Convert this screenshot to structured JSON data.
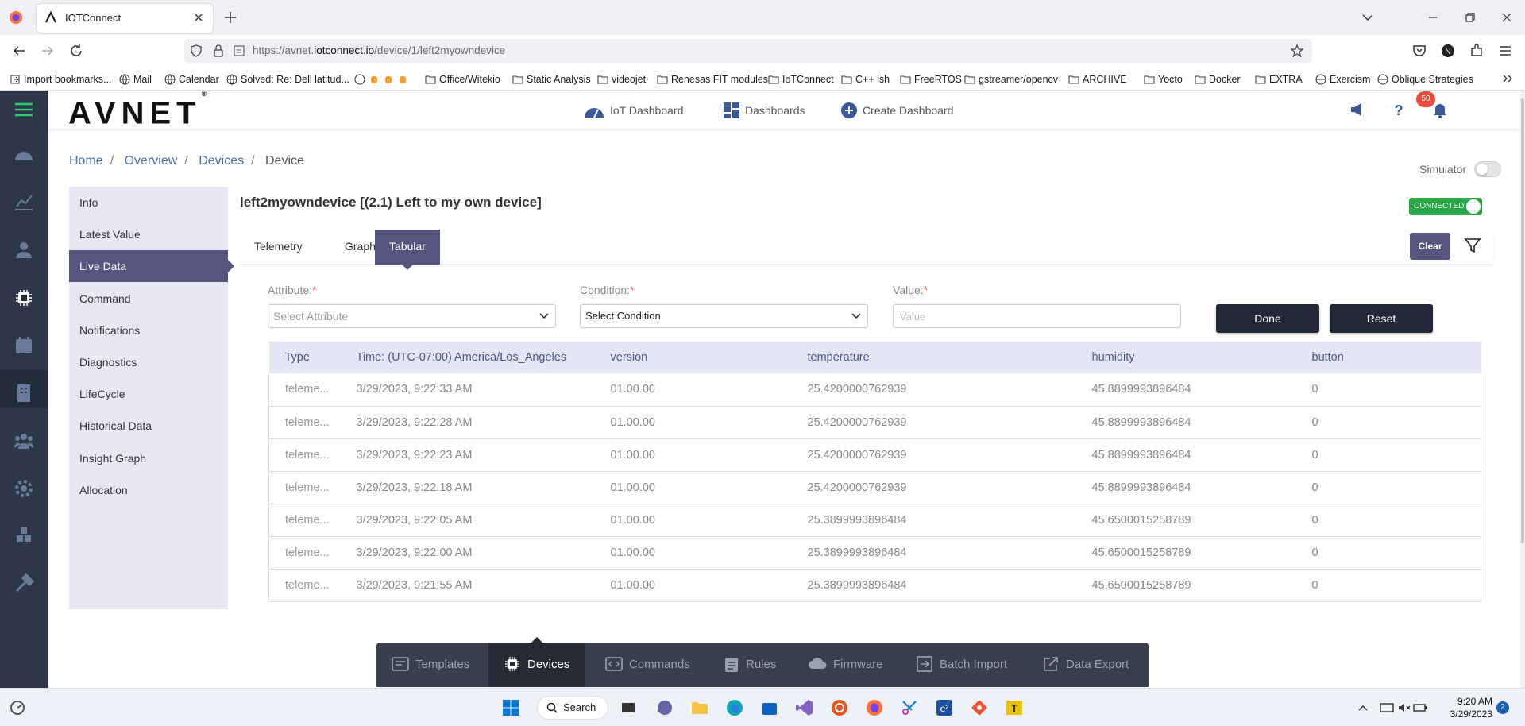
{
  "browser": {
    "tab_title": "IOTConnect",
    "url_prefix": "https://avnet.",
    "url_domain": "iotconnect.io",
    "url_path": "/device/1/left2myowndevice",
    "bookmarks": [
      "Import bookmarks...",
      "Mail",
      "Calendar",
      "Solved: Re: Dell latitud...",
      "Office/Witekio",
      "Static Analysis",
      "videojet",
      "Renesas FIT modules",
      "IoTConnect",
      "C++ ish",
      "FreeRTOS",
      "gstreamer/opencv",
      "ARCHIVE",
      "Yocto",
      "Docker",
      "EXTRA",
      "Exercism",
      "Oblique Strategies"
    ]
  },
  "header": {
    "logo": "AVNET",
    "logo_mark": "®",
    "nav": [
      "IoT Dashboard",
      "Dashboards",
      "Create Dashboard"
    ],
    "notification_count": "50"
  },
  "breadcrumb": [
    "Home",
    "Overview",
    "Devices",
    "Device"
  ],
  "simulator_label": "Simulator",
  "side_menu": [
    "Info",
    "Latest Value",
    "Live Data",
    "Command",
    "Notifications",
    "Diagnostics",
    "LifeCycle",
    "Historical Data",
    "Insight Graph",
    "Allocation"
  ],
  "device": {
    "title": "left2myowndevice [(2.1) Left to my own device]",
    "status": "CONNECTED"
  },
  "tabs": [
    "Telemetry",
    "Graph",
    "Tabular"
  ],
  "clear_label": "Clear",
  "filter": {
    "attribute_label": "Attribute:",
    "attribute_placeholder": "Select Attribute",
    "condition_label": "Condition:",
    "condition_value": "Select Condition",
    "value_label": "Value:",
    "value_placeholder": "Value",
    "required_mark": "*",
    "done_label": "Done",
    "reset_label": "Reset"
  },
  "table": {
    "columns": [
      "Type",
      "Time: (UTC-07:00) America/Los_Angeles",
      "version",
      "temperature",
      "humidity",
      "button"
    ],
    "rows": [
      [
        "teleme...",
        "3/29/2023, 9:22:33 AM",
        "01.00.00",
        "25.4200000762939",
        "45.8899993896484",
        "0"
      ],
      [
        "teleme...",
        "3/29/2023, 9:22:28 AM",
        "01.00.00",
        "25.4200000762939",
        "45.8899993896484",
        "0"
      ],
      [
        "teleme...",
        "3/29/2023, 9:22:23 AM",
        "01.00.00",
        "25.4200000762939",
        "45.8899993896484",
        "0"
      ],
      [
        "teleme...",
        "3/29/2023, 9:22:18 AM",
        "01.00.00",
        "25.4200000762939",
        "45.8899993896484",
        "0"
      ],
      [
        "teleme...",
        "3/29/2023, 9:22:05 AM",
        "01.00.00",
        "25.3899993896484",
        "45.6500015258789",
        "0"
      ],
      [
        "teleme...",
        "3/29/2023, 9:22:00 AM",
        "01.00.00",
        "25.3899993896484",
        "45.6500015258789",
        "0"
      ],
      [
        "teleme...",
        "3/29/2023, 9:21:55 AM",
        "01.00.00",
        "25.3899993896484",
        "45.6500015258789",
        "0"
      ]
    ]
  },
  "bottom_nav": [
    "Templates",
    "Devices",
    "Commands",
    "Rules",
    "Firmware",
    "Batch Import",
    "Data Export"
  ],
  "taskbar": {
    "search": "Search",
    "time": "9:20 AM",
    "date": "3/29/2023",
    "notification_count": "2"
  },
  "colors": {
    "accent": "#55557f",
    "rail": "#2d3748",
    "connected": "#28a745"
  }
}
